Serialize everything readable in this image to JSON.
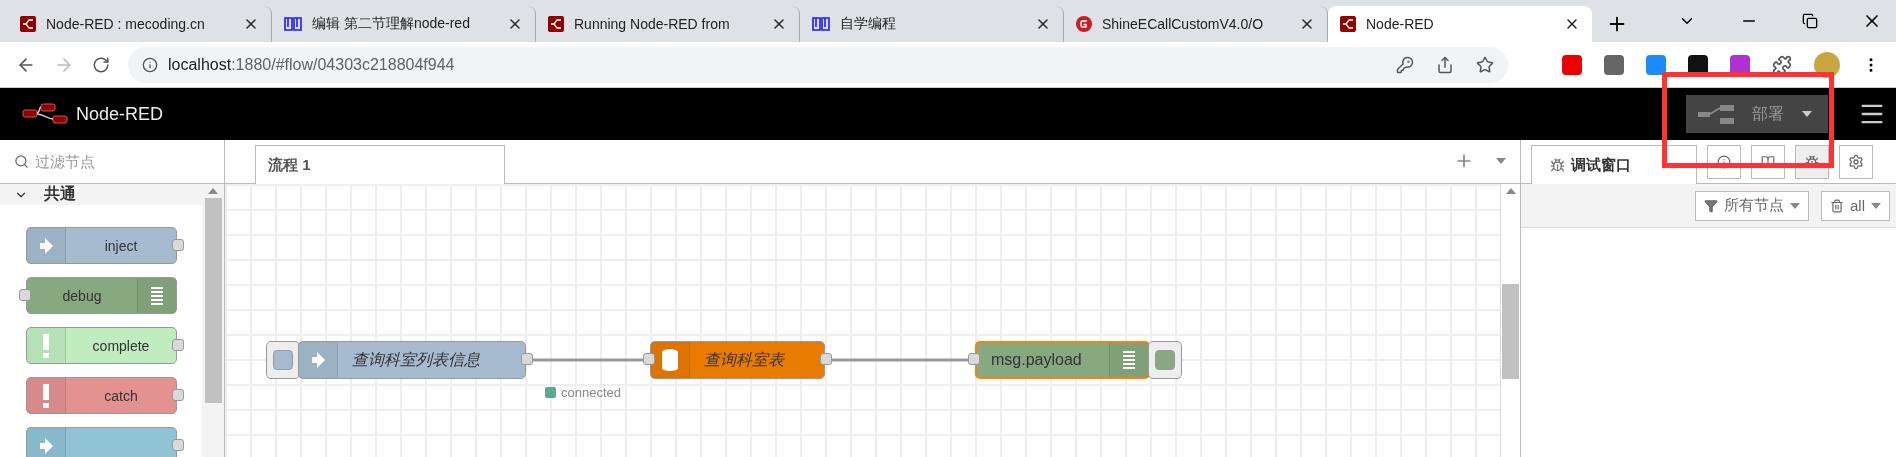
{
  "browser": {
    "tabs": [
      {
        "title": "Node-RED : mecoding.cn",
        "kind": "flow",
        "selected": false
      },
      {
        "title": "编辑 第二节理解node-red",
        "kind": "blocks",
        "selected": false
      },
      {
        "title": "Running Node-RED from",
        "kind": "flow",
        "selected": false
      },
      {
        "title": "自学编程",
        "kind": "blocks",
        "selected": false
      },
      {
        "title": "ShineECallCustomV4.0/O",
        "kind": "git",
        "selected": false
      },
      {
        "title": "Node-RED",
        "kind": "flow",
        "selected": true
      }
    ],
    "address": {
      "host": "localhost",
      "path": ":1880/#flow/04303c218804f944"
    }
  },
  "header": {
    "title": "Node-RED",
    "deploy": {
      "label": "部署"
    }
  },
  "palette": {
    "search": {
      "placeholder": "过滤节点"
    },
    "category": {
      "label": "共通",
      "expanded": true
    },
    "nodes": [
      {
        "label": "inject",
        "kind": "input",
        "color": "#a6bbcf"
      },
      {
        "label": "debug",
        "kind": "output",
        "color": "#87a980"
      },
      {
        "label": "complete",
        "kind": "input",
        "color": "#c0edc0"
      },
      {
        "label": "catch",
        "kind": "input",
        "color": "#e49191"
      },
      {
        "kind": "input",
        "color": "#8fc3d5"
      }
    ]
  },
  "workspace": {
    "tabs": [
      {
        "label": "流程 1",
        "selected": true
      }
    ],
    "nodes": [
      {
        "label": "查询科室列表信息",
        "kind": "inject",
        "selected": false
      },
      {
        "label": "查询科室表",
        "kind": "database",
        "selected": false,
        "status": {
          "text": "connected",
          "color": "#5aab8a"
        }
      },
      {
        "label": "msg.payload",
        "kind": "debug",
        "selected": true,
        "active": true
      }
    ]
  },
  "sidebar": {
    "tabs": [
      {
        "label": "调试窗口",
        "selected": true
      }
    ],
    "filter": {
      "label": "所有节点"
    },
    "clear": {
      "label": "all"
    }
  }
}
